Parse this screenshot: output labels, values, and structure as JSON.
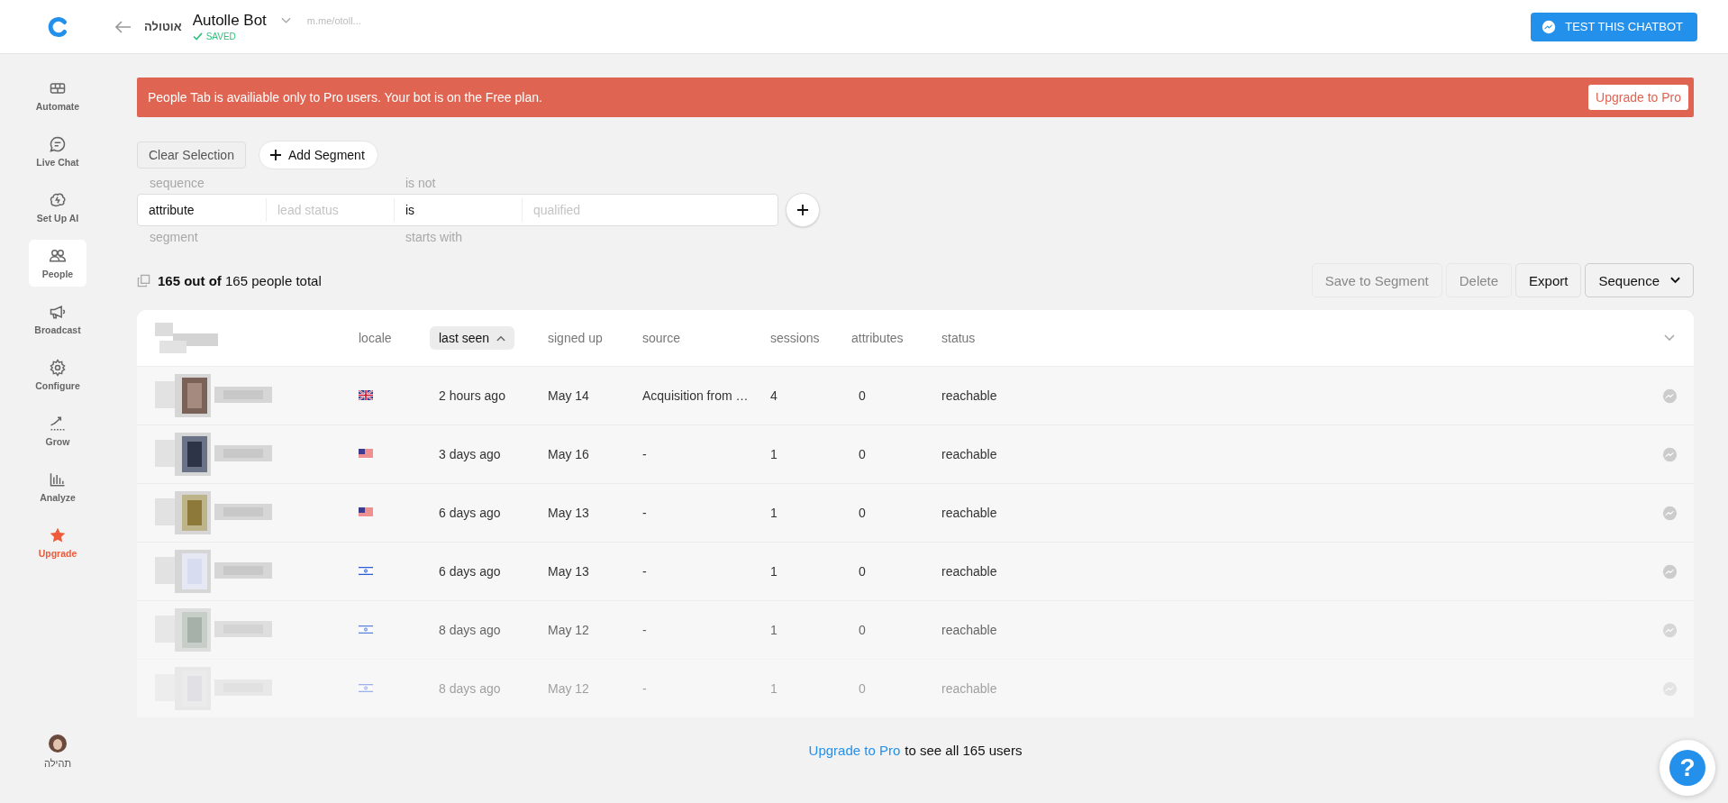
{
  "header": {
    "bot_logo_text": "אוטולה",
    "bot_name": "Autolle Bot",
    "bot_link": "m.me/otoll...",
    "save_status": "SAVED",
    "test_button": "TEST THIS CHATBOT"
  },
  "sidebar": {
    "items": [
      {
        "label": "Automate",
        "selected": false,
        "kind": "nav"
      },
      {
        "label": "Live Chat",
        "selected": false,
        "kind": "nav"
      },
      {
        "label": "Set Up AI",
        "selected": false,
        "kind": "nav"
      },
      {
        "label": "People",
        "selected": true,
        "kind": "nav"
      },
      {
        "label": "Broadcast",
        "selected": false,
        "kind": "nav"
      },
      {
        "label": "Configure",
        "selected": false,
        "kind": "nav"
      },
      {
        "label": "Grow",
        "selected": false,
        "kind": "nav"
      },
      {
        "label": "Analyze",
        "selected": false,
        "kind": "nav"
      },
      {
        "label": "Upgrade",
        "selected": false,
        "kind": "upgrade"
      }
    ],
    "user_name": "תהילה"
  },
  "banner": {
    "message": "People Tab is availiable only to Pro users. Your bot is on the Free plan.",
    "button": "Upgrade to Pro"
  },
  "segment_bar": {
    "clear_button": "Clear Selection",
    "add_button": "Add Segment"
  },
  "filter": {
    "fields": [
      {
        "value": "attribute",
        "above": "sequence",
        "below": "segment"
      },
      {
        "placeholder": "lead status"
      },
      {
        "value": "is",
        "above": "is not",
        "below": "starts with"
      },
      {
        "placeholder": "qualified"
      }
    ]
  },
  "count_text": "**165 out of** 165 people total",
  "actions": [
    {
      "label": "Save to Segment",
      "disabled": true,
      "kind": "button"
    },
    {
      "label": "Delete",
      "disabled": true,
      "kind": "button"
    },
    {
      "label": "Export",
      "disabled": false,
      "kind": "button"
    },
    {
      "label": "Sequence",
      "disabled": false,
      "kind": "dropdown"
    }
  ],
  "table": {
    "columns": [
      {
        "label": "locale",
        "sorted": false
      },
      {
        "label": "last seen",
        "sorted": true
      },
      {
        "label": "signed up",
        "sorted": false
      },
      {
        "label": "source",
        "sorted": false
      },
      {
        "label": "sessions",
        "sorted": false
      },
      {
        "label": "attributes",
        "sorted": false
      },
      {
        "label": "status",
        "sorted": false
      }
    ],
    "rows": [
      {
        "locale": {
          "kind": "gb"
        },
        "last_seen": "2 hours ago",
        "signed_up": "May 14",
        "source": "Acquisition from …",
        "sessions": "4",
        "attributes": "0",
        "status": "reachable"
      },
      {
        "locale": {
          "kind": "us"
        },
        "last_seen": "3 days ago",
        "signed_up": "May 16",
        "source": "-",
        "sessions": "1",
        "attributes": "0",
        "status": "reachable"
      },
      {
        "locale": {
          "kind": "us"
        },
        "last_seen": "6 days ago",
        "signed_up": "May 13",
        "source": "-",
        "sessions": "1",
        "attributes": "0",
        "status": "reachable"
      },
      {
        "locale": {
          "kind": "il"
        },
        "last_seen": "6 days ago",
        "signed_up": "May 13",
        "source": "-",
        "sessions": "1",
        "attributes": "0",
        "status": "reachable"
      },
      {
        "locale": {
          "kind": "il"
        },
        "last_seen": "8 days ago",
        "signed_up": "May 12",
        "source": "-",
        "sessions": "1",
        "attributes": "0",
        "status": "reachable"
      },
      {
        "locale": {
          "kind": "il"
        },
        "last_seen": "8 days ago",
        "signed_up": "May 12",
        "source": "-",
        "sessions": "1",
        "attributes": "0",
        "status": "reachable"
      }
    ]
  },
  "footer": {
    "link": "Upgrade to Pro",
    "text": "to see all 165 users"
  },
  "help_button": "?"
}
